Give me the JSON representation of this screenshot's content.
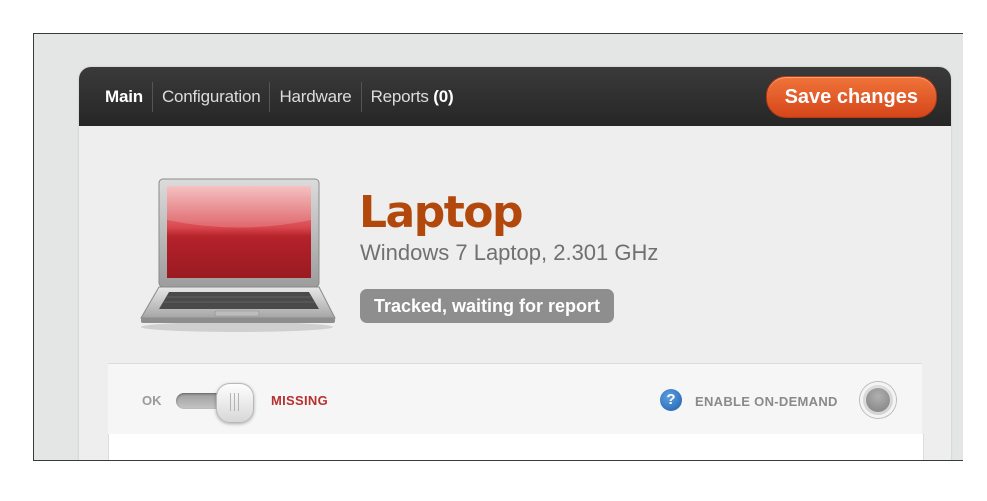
{
  "tabs": [
    {
      "label": "Main",
      "active": true
    },
    {
      "label": "Configuration",
      "active": false
    },
    {
      "label": "Hardware",
      "active": false
    },
    {
      "label": "Reports",
      "count": "(0)",
      "active": false
    }
  ],
  "toolbar": {
    "save_label": "Save changes"
  },
  "device": {
    "name": "Laptop",
    "description": "Windows 7 Laptop, 2.301 GHz",
    "status": "Tracked, waiting for report",
    "icon": "laptop-icon"
  },
  "controls": {
    "ok_label": "OK",
    "missing_label": "MISSING",
    "ondemand_label": "ENABLE ON-DEMAND",
    "help_glyph": "?"
  },
  "colors": {
    "accent": "#d5461a",
    "device_name": "#b2480c",
    "missing": "#b83030",
    "topbar": "#2b2b2b"
  }
}
